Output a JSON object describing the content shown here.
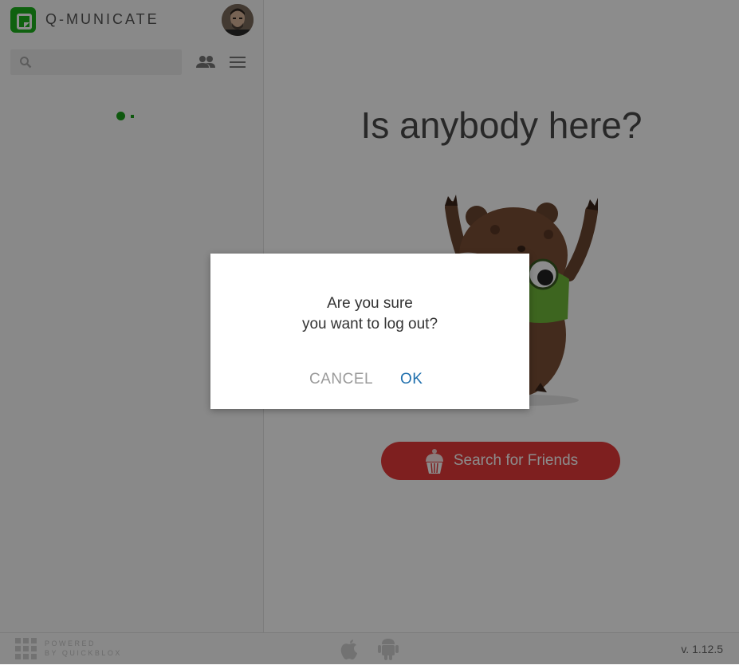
{
  "app": {
    "title": "Q-MUNICATE"
  },
  "sidebar": {
    "search": {
      "placeholder": "",
      "value": ""
    },
    "contacts_icon": "contacts-icon",
    "menu_icon": "hamburger-menu-icon"
  },
  "main": {
    "empty_title": "Is anybody here?",
    "search_friends_label": "Search for Friends"
  },
  "footer": {
    "powered_line1": "POWERED",
    "powered_line2": "BY QUICKBLOX",
    "version": "v. 1.12.5"
  },
  "dialog": {
    "line1": "Are you sure",
    "line2": "you want to log out?",
    "cancel_label": "CANCEL",
    "ok_label": "OK"
  },
  "colors": {
    "brand_green": "#1cb11c",
    "button_red": "#e53a3a",
    "ok_blue": "#1f6fad"
  }
}
